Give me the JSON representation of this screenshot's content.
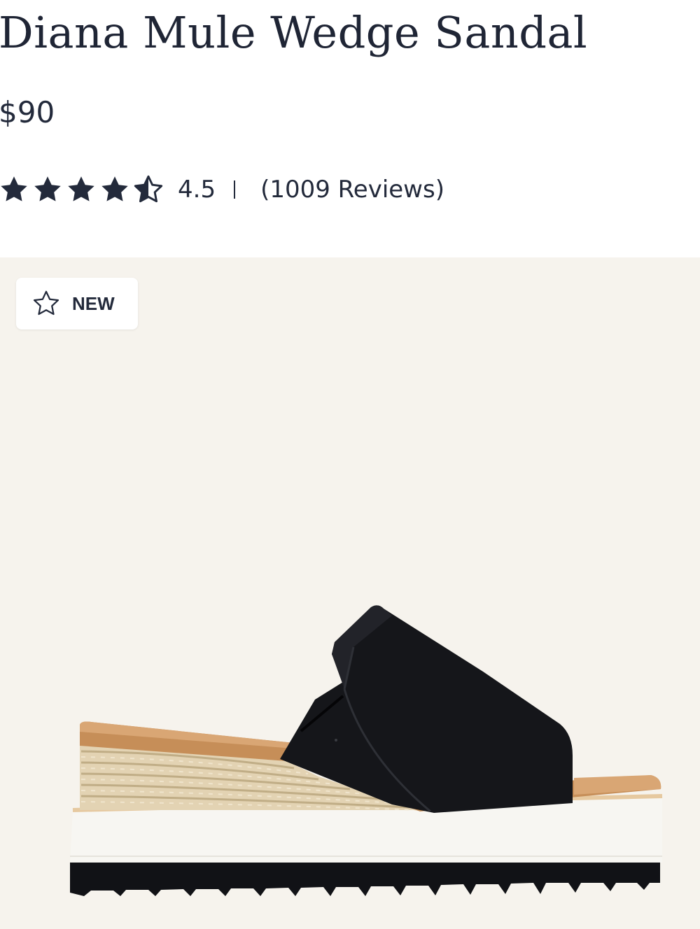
{
  "product": {
    "title": "Diana Mule Wedge Sandal",
    "price": "$90",
    "rating": {
      "stars": 4.5,
      "value": "4.5",
      "separator": "|",
      "reviews": "(1009 Reviews)"
    },
    "badge": {
      "label": "NEW",
      "icon": "star-outline-icon"
    },
    "image": {
      "subject": "black-mule-wedge-sandal"
    }
  },
  "colors": {
    "text": "#232a3b",
    "image_background": "#f6f3ed",
    "badge_background": "#ffffff"
  }
}
